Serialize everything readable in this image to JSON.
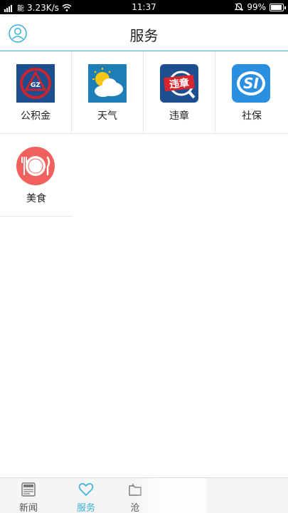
{
  "status_bar": {
    "carrier": "能",
    "speed": "3.23K/s",
    "time": "11:37",
    "battery": "99%",
    "battery_level": 0.99,
    "icons": [
      "signal-icon",
      "wifi-icon",
      "bell-muted-icon",
      "battery-icon"
    ]
  },
  "header": {
    "title": "服务",
    "left_icon": "user-profile-icon",
    "accent_color": "#35b0d8"
  },
  "services": [
    {
      "label": "公积金",
      "icon": "housing-fund-icon"
    },
    {
      "label": "天气",
      "icon": "weather-icon"
    },
    {
      "label": "违章",
      "icon": "traffic-violation-icon"
    },
    {
      "label": "社保",
      "icon": "social-security-icon"
    },
    {
      "label": "美食",
      "icon": "food-icon"
    }
  ],
  "bottom_nav": {
    "items": [
      {
        "label": "新闻",
        "icon": "news-icon",
        "active": false
      },
      {
        "label": "服务",
        "icon": "heart-icon",
        "active": true
      },
      {
        "label": "沧",
        "icon": "folder-icon",
        "active": false
      }
    ]
  }
}
